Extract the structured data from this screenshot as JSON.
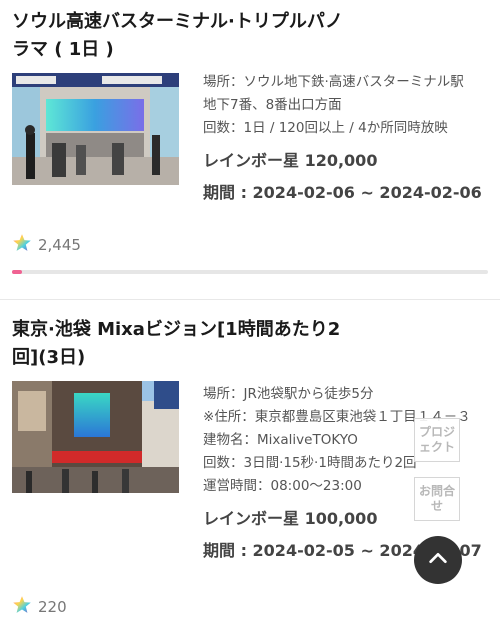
{
  "cards": [
    {
      "title": "ソウル高速バスターミナル·トリプルパノラマ ( 1日 )",
      "info": [
        "場所：ソウル地下鉄·高速バスターミナル駅",
        "地下7番、8番出口方面",
        "回数：1日 / 120回以上 / 4か所同時放映"
      ],
      "price": "レインボー星 120,000",
      "period": "期間 : 2024-02-06 ~ 2024-02-06",
      "likes": "2,445",
      "progress": 0.02
    },
    {
      "title": "東京·池袋 Mixaビジョン[1時間あたり2回](3日)",
      "info": [
        "場所：JR池袋駅から徒歩5分",
        "※住所：東京都豊島区東池袋１丁目１４－３",
        "建物名：MixaliveTOKYO",
        "回数：3日間·15秒·1時間あたり2回",
        "運営時間：08:00～23:00"
      ],
      "price": "レインボー星 100,000",
      "period": "期間 : 2024-02-05 ~ 2024-02-07",
      "likes": "220"
    }
  ],
  "floating": {
    "project_label": "プロジェクト",
    "inquiry_label": "お問合せ"
  },
  "colors": {
    "accent": "#f06292",
    "star": "rainbow"
  },
  "icons": {
    "star": "rainbow-star-icon",
    "scroll_top": "chevron-up-icon"
  }
}
